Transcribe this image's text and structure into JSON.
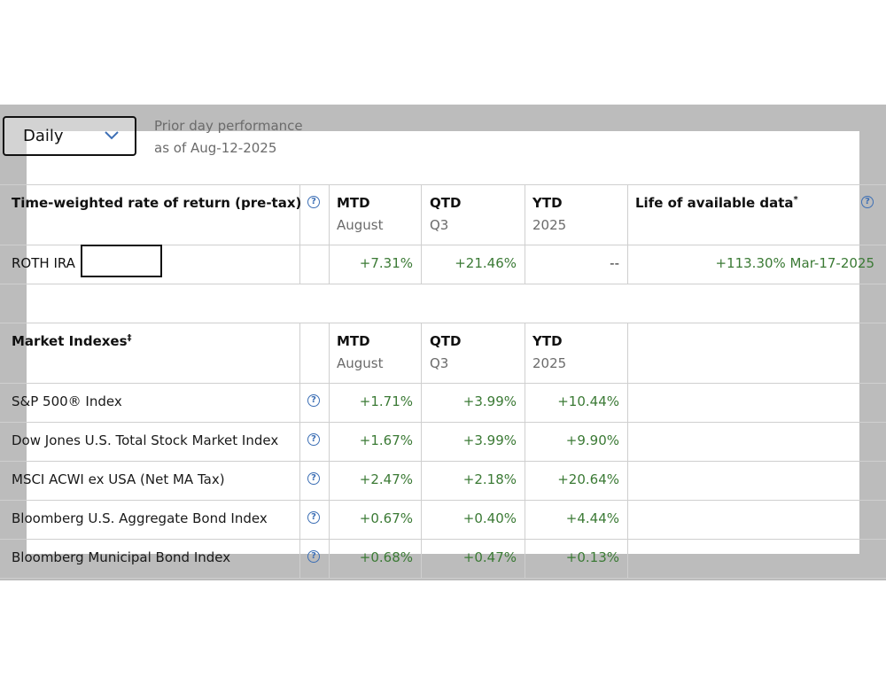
{
  "period_select": {
    "value": "Daily",
    "icon": "chevron-down-icon"
  },
  "prior_note": {
    "line1": "Prior day performance",
    "line2": "as of Aug-12-2025"
  },
  "returns": {
    "header": "Time-weighted rate of return (pre-tax)",
    "columns": [
      {
        "label": "MTD",
        "sub": "August"
      },
      {
        "label": "QTD",
        "sub": "Q3"
      },
      {
        "label": "YTD",
        "sub": "2025"
      }
    ],
    "life_header": "Life of available data",
    "life_mark": "*",
    "account": {
      "name": "ROTH IRA",
      "mtd": "+7.31%",
      "qtd": "+21.46%",
      "ytd": "--",
      "life": "+113.30% Mar-17-2025"
    }
  },
  "indexes": {
    "header": "Market Indexes",
    "header_mark": "‡",
    "columns": [
      {
        "label": "MTD",
        "sub": "August"
      },
      {
        "label": "QTD",
        "sub": "Q3"
      },
      {
        "label": "YTD",
        "sub": "2025"
      }
    ],
    "rows": [
      {
        "name": "S&P 500® Index",
        "mtd": "+1.71%",
        "qtd": "+3.99%",
        "ytd": "+10.44%"
      },
      {
        "name": "Dow Jones U.S. Total Stock Market Index",
        "mtd": "+1.67%",
        "qtd": "+3.99%",
        "ytd": "+9.90%"
      },
      {
        "name": "MSCI ACWI ex USA (Net MA Tax)",
        "mtd": "+2.47%",
        "qtd": "+2.18%",
        "ytd": "+20.64%"
      },
      {
        "name": "Bloomberg U.S. Aggregate Bond Index",
        "mtd": "+0.67%",
        "qtd": "+0.40%",
        "ytd": "+4.44%"
      },
      {
        "name": "Bloomberg Municipal Bond Index",
        "mtd": "+0.68%",
        "qtd": "+0.47%",
        "ytd": "+0.13%"
      }
    ]
  },
  "colors": {
    "positive": "#3b7a35",
    "help": "#3d6fb5",
    "overlay": "#bcbcbc"
  }
}
